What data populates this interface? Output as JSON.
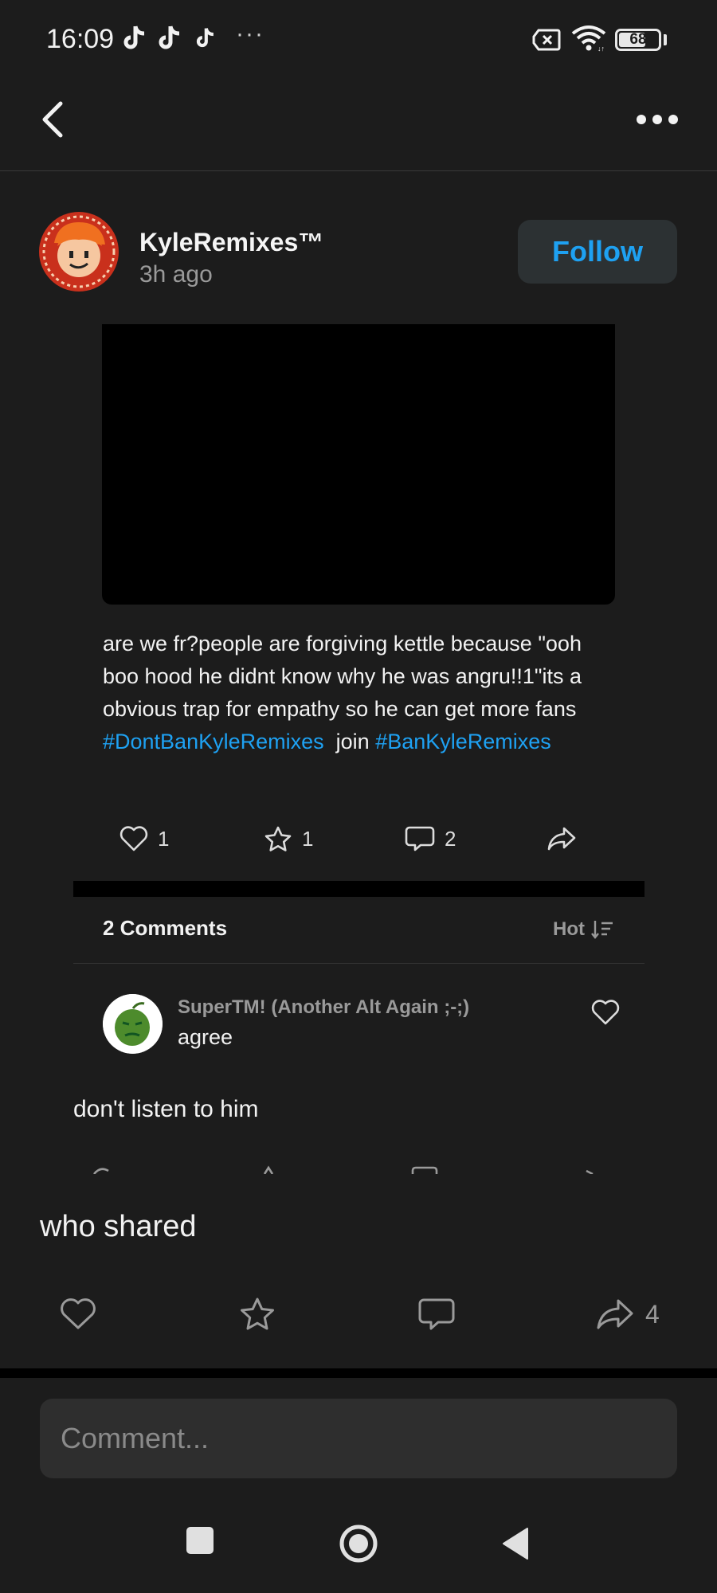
{
  "status_bar": {
    "time": "16:09",
    "dots": "···",
    "battery_percent": 68,
    "battery_label": "68",
    "icons": [
      "tiktok-icon",
      "tiktok-icon",
      "tiktok-icon",
      "sim-x-icon",
      "wifi-icon",
      "battery-icon"
    ]
  },
  "header": {
    "back_icon": "chevron-left-icon",
    "more_icon": "more-horizontal-icon"
  },
  "post": {
    "author": "KyleRemixes™",
    "time": "3h ago",
    "follow_label": "Follow",
    "body_text": "are we fr?people are forgiving kettle because \"ooh boo hood he didnt know why he was angru!!1\"its a obvious trap for empathy so he can get more fans",
    "hashtag_1": "#DontBanKyleRemixes",
    "join_text": "join",
    "hashtag_2": "#BanKyleRemixes",
    "actions": {
      "likes": "1",
      "favorites": "1",
      "comments": "2"
    }
  },
  "comments": {
    "header": "2 Comments",
    "sort_label": "Hot",
    "items": [
      {
        "author": "SuperTM! (Another Alt Again ;-;)",
        "text": "agree"
      }
    ]
  },
  "reply_text": "don't listen to him",
  "share_text": "who shared",
  "bottom_actions": {
    "share_count": "4"
  },
  "comment_input": {
    "placeholder": "Comment..."
  },
  "colors": {
    "background": "#1c1c1c",
    "accent": "#1ea1f2",
    "muted_text": "#9a9a9a",
    "follow_bg": "#2c3133"
  }
}
